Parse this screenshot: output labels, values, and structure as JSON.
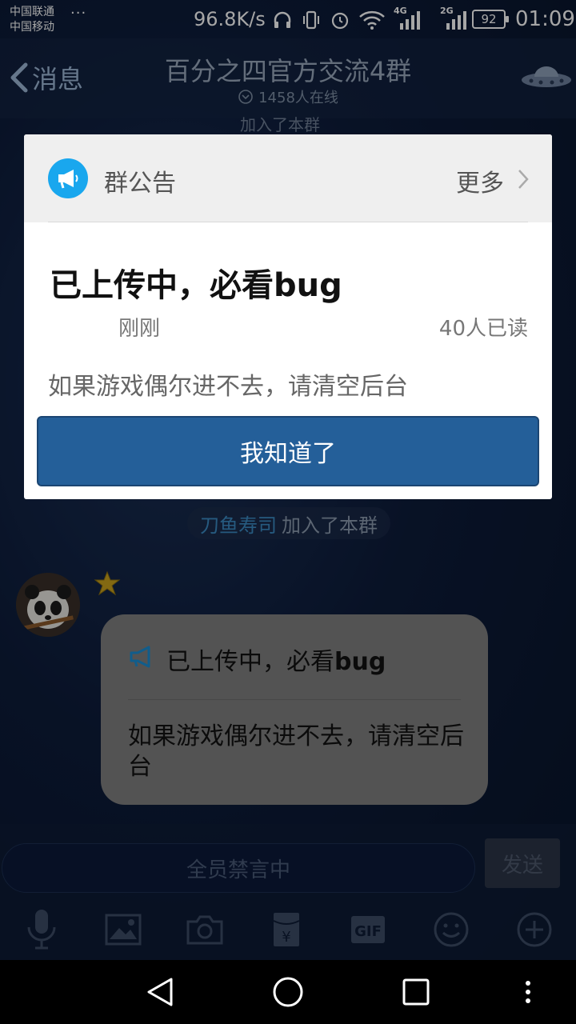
{
  "status_bar": {
    "carrier_1": "中国联通",
    "carrier_2": "中国移动",
    "more_dots": "···",
    "net_speed": "96.8K/s",
    "signal_1_label": "4G",
    "signal_2_label": "2G",
    "battery": "92",
    "time": "01:09"
  },
  "header": {
    "back_label": "消息",
    "title": "百分之四官方交流4群",
    "online": "1458人在线",
    "partial_system_text": "加入了本群"
  },
  "announcement_modal": {
    "section_label": "群公告",
    "more_label": "更多",
    "title": "已上传中，必看bug",
    "time": "刚刚",
    "read_count": "40人已读",
    "body": "如果游戏偶尔进不去，请清空后台",
    "confirm_button": "我知道了",
    "accent_color": "#19a7ee",
    "button_color": "#245f99"
  },
  "chat": {
    "system_message": {
      "name": "刀鱼寿司",
      "text": "加入了本群"
    },
    "message": {
      "title_prefix": "已上传中，必看",
      "title_suffix": "bug",
      "body": "如果游戏偶尔进不去，请清空后台"
    }
  },
  "input_bar": {
    "placeholder": "全员禁言中",
    "send_label": "发送"
  },
  "toolbar_icons": [
    "mic-icon",
    "image-icon",
    "camera-icon",
    "red-packet-icon",
    "gif-icon",
    "emoji-icon",
    "plus-icon"
  ],
  "nav_icons": [
    "back-triangle-icon",
    "home-circle-icon",
    "recents-square-icon",
    "menu-dots-icon"
  ]
}
